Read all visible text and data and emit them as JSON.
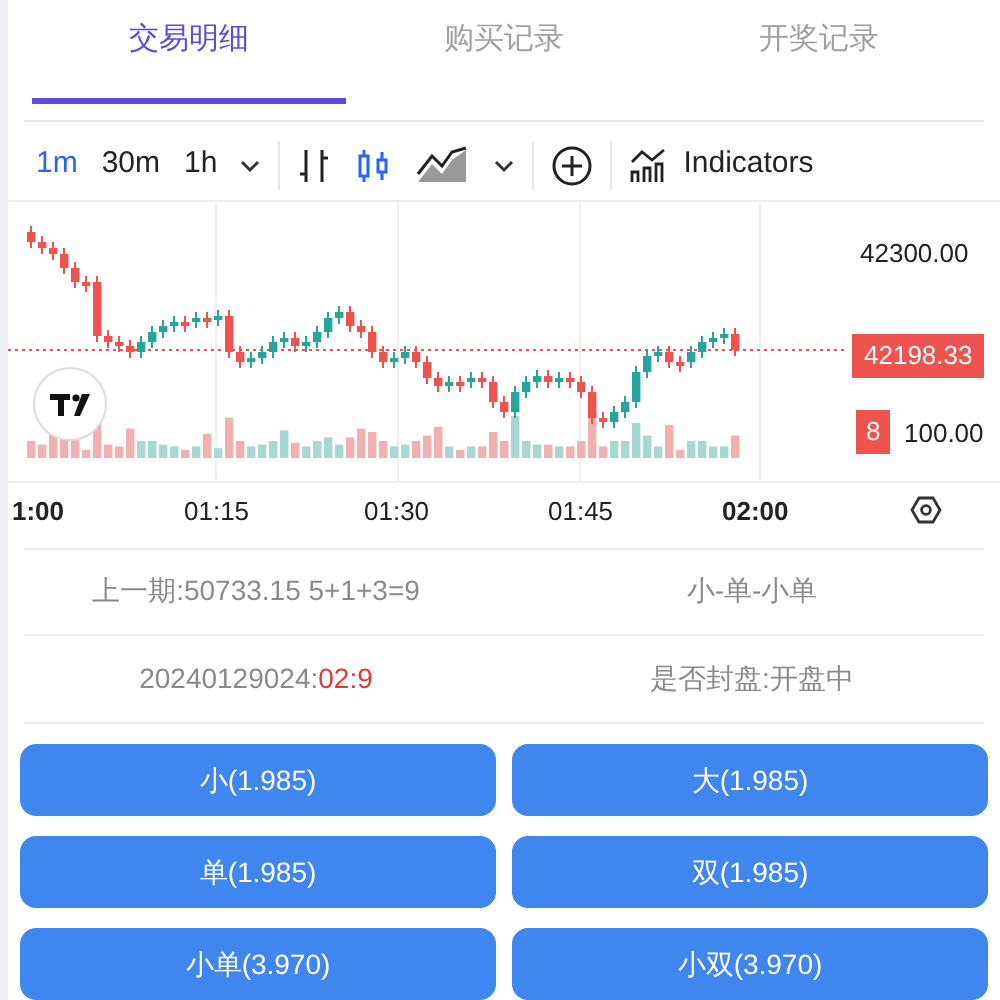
{
  "tabs": [
    {
      "label": "交易明细",
      "selected": true
    },
    {
      "label": "购买记录",
      "selected": false
    },
    {
      "label": "开奖记录",
      "selected": false
    }
  ],
  "toolbar": {
    "intervals": [
      {
        "label": "1m",
        "selected": true
      },
      {
        "label": "30m",
        "selected": false
      },
      {
        "label": "1h",
        "selected": false
      }
    ],
    "chart_types": [
      {
        "kind": "bars",
        "selected": false
      },
      {
        "kind": "candles",
        "selected": true
      },
      {
        "kind": "area",
        "selected": false
      }
    ],
    "indicators_label": "Indicators"
  },
  "chart": {
    "price_ticks": [
      "42300.00",
      "100.00"
    ],
    "last_price": "42198.33",
    "volume_label": "8",
    "time_ticks": [
      {
        "label": "1:00",
        "bold": true
      },
      {
        "label": "01:15",
        "bold": false
      },
      {
        "label": "01:30",
        "bold": false
      },
      {
        "label": "01:45",
        "bold": false
      },
      {
        "label": "02:00",
        "bold": true
      }
    ]
  },
  "info": {
    "previous": "上一期:50733.15 5+1+3=9",
    "previous_result": "小-单-小单",
    "period": "20240129024:",
    "countdown": "02:9",
    "status": "是否封盘:开盘中"
  },
  "bets": [
    "小(1.985)",
    "大(1.985)",
    "单(1.985)",
    "双(1.985)",
    "小单(3.970)",
    "小双(3.970)"
  ]
}
